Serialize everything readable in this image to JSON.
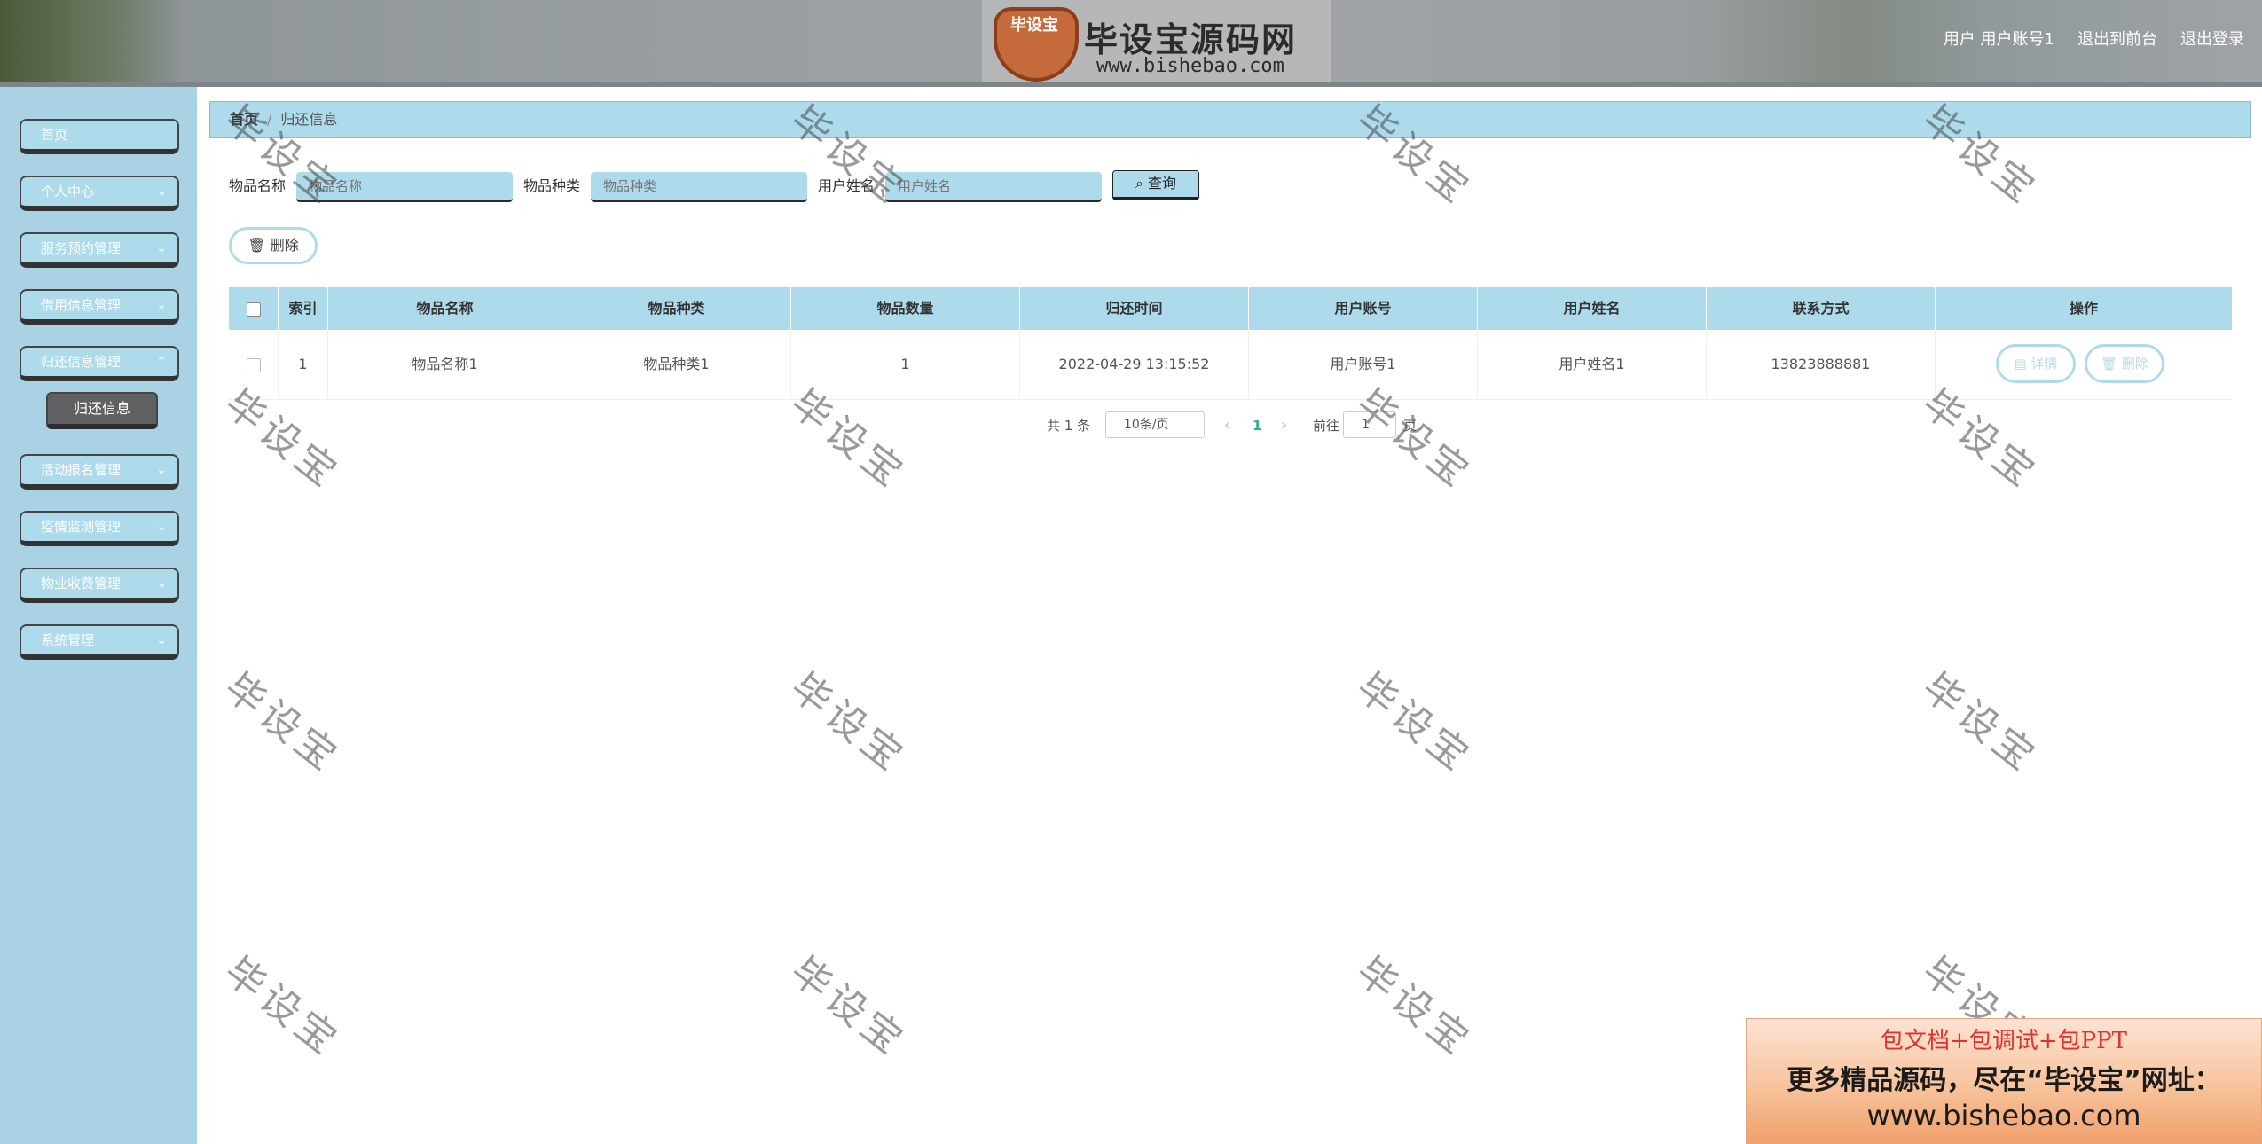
{
  "header": {
    "logo_badge": "毕设宝",
    "logo_title": "毕设宝源码网",
    "logo_url": "www.bishebao.com",
    "user_label": "用户 用户账号1",
    "front_link": "退出到前台",
    "logout_link": "退出登录"
  },
  "sidebar": {
    "items": [
      {
        "label": "首页"
      },
      {
        "label": "个人中心"
      },
      {
        "label": "服务预约管理"
      },
      {
        "label": "借用信息管理"
      },
      {
        "label": "归还信息管理"
      },
      {
        "label": "活动报名管理"
      },
      {
        "label": "疫情监测管理"
      },
      {
        "label": "物业收费管理"
      },
      {
        "label": "系统管理"
      }
    ],
    "active_sub": "归还信息"
  },
  "breadcrumb": {
    "home": "首页",
    "separator": "/",
    "current": "归还信息"
  },
  "search": {
    "name_label": "物品名称",
    "name_placeholder": "物品名称",
    "category_label": "物品种类",
    "category_placeholder": "物品种类",
    "user_label": "用户姓名",
    "user_placeholder": "用户姓名",
    "query_button": "查询"
  },
  "toolbar": {
    "delete_button": "删除"
  },
  "table": {
    "headers": [
      "索引",
      "物品名称",
      "物品种类",
      "物品数量",
      "归还时间",
      "用户账号",
      "用户姓名",
      "联系方式",
      "操作"
    ],
    "rows": [
      {
        "index": "1",
        "name": "物品名称1",
        "category": "物品种类1",
        "quantity": "1",
        "time": "2022-04-29 13:15:52",
        "account": "用户账号1",
        "user_name": "用户姓名1",
        "phone": "13823888881",
        "detail": "详情",
        "delete": "删除"
      }
    ]
  },
  "pagination": {
    "total": "共 1 条",
    "page_size": "10条/页",
    "current": "1",
    "goto_label": "前往",
    "goto_value": "1",
    "goto_suffix": "页"
  },
  "watermark": "毕设宝",
  "ad": {
    "line1": "包文档+包调试+包PPT",
    "line2": "更多精品源码，尽在“毕设宝”网址：",
    "line3": "www.bishebao.com"
  },
  "colors": {
    "accent": "#aedbeb",
    "sidebar_bg": "#a9d3e4",
    "active_item": "#5f6062"
  }
}
